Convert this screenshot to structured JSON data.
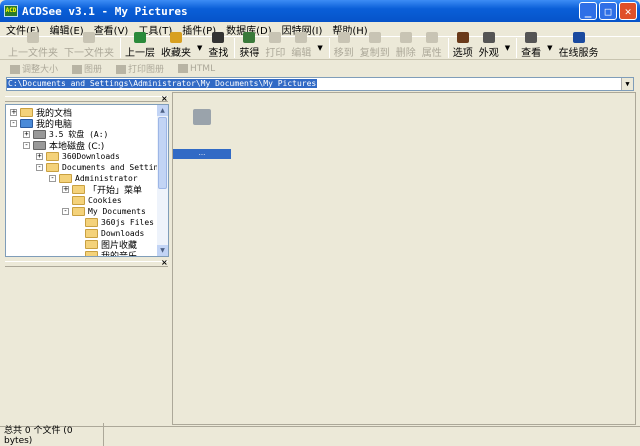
{
  "window": {
    "title": "ACDSee v3.1 - My Pictures",
    "icon": "acdsee-app-icon"
  },
  "menu": [
    "文件(F)",
    "编辑(E)",
    "查看(V)",
    "工具(T)",
    "插件(P)",
    "数据库(D)",
    "因特网(I)",
    "帮助(H)"
  ],
  "toolbar": [
    {
      "label": "上一文件夹",
      "enabled": false
    },
    {
      "label": "下一文件夹",
      "enabled": false
    },
    {
      "label": "上一层",
      "enabled": true
    },
    {
      "label": "收藏夹",
      "enabled": true
    },
    {
      "label": "查找",
      "enabled": true
    },
    {
      "label": "获得",
      "enabled": true
    },
    {
      "label": "打印",
      "enabled": false
    },
    {
      "label": "编辑",
      "enabled": false
    },
    {
      "label": "移到",
      "enabled": false
    },
    {
      "label": "复制到",
      "enabled": false
    },
    {
      "label": "删除",
      "enabled": false
    },
    {
      "label": "属性",
      "enabled": false
    },
    {
      "label": "选项",
      "enabled": true
    },
    {
      "label": "外观",
      "enabled": true
    },
    {
      "label": "查看",
      "enabled": true
    },
    {
      "label": "在线服务",
      "enabled": true
    }
  ],
  "toolbar2": [
    "调整大小",
    "图册",
    "打印图册",
    "HTML"
  ],
  "address": {
    "value": "C:\\Documents and Settings\\Administrator\\My Documents\\My Pictures"
  },
  "tree": [
    {
      "label": "我的文档",
      "level": 0,
      "exp": "+"
    },
    {
      "label": "我的电脑",
      "level": 0,
      "exp": "-"
    },
    {
      "label": "3.5 软盘 (A:)",
      "level": 1,
      "exp": "+"
    },
    {
      "label": "本地磁盘 (C:)",
      "level": 1,
      "exp": "-"
    },
    {
      "label": "360Downloads",
      "level": 2,
      "exp": "+"
    },
    {
      "label": "Documents and Settings",
      "level": 2,
      "exp": "-"
    },
    {
      "label": "Administrator",
      "level": 3,
      "exp": "-"
    },
    {
      "label": "「开始」菜单",
      "level": 4,
      "exp": "+"
    },
    {
      "label": "Cookies",
      "level": 4,
      "exp": ""
    },
    {
      "label": "My Documents",
      "level": 4,
      "exp": "-"
    },
    {
      "label": "360js Files",
      "level": 5,
      "exp": ""
    },
    {
      "label": "Downloads",
      "level": 5,
      "exp": ""
    },
    {
      "label": "图片收藏",
      "level": 5,
      "exp": ""
    },
    {
      "label": "我的音乐",
      "level": 5,
      "exp": ""
    }
  ],
  "main": {
    "selected_label": "..."
  },
  "status": {
    "text": "总共 0 个文件 (0 bytes)"
  },
  "colors": {
    "title": "#0a5fd8",
    "selection": "#316ac5",
    "face": "#ece9d8"
  }
}
